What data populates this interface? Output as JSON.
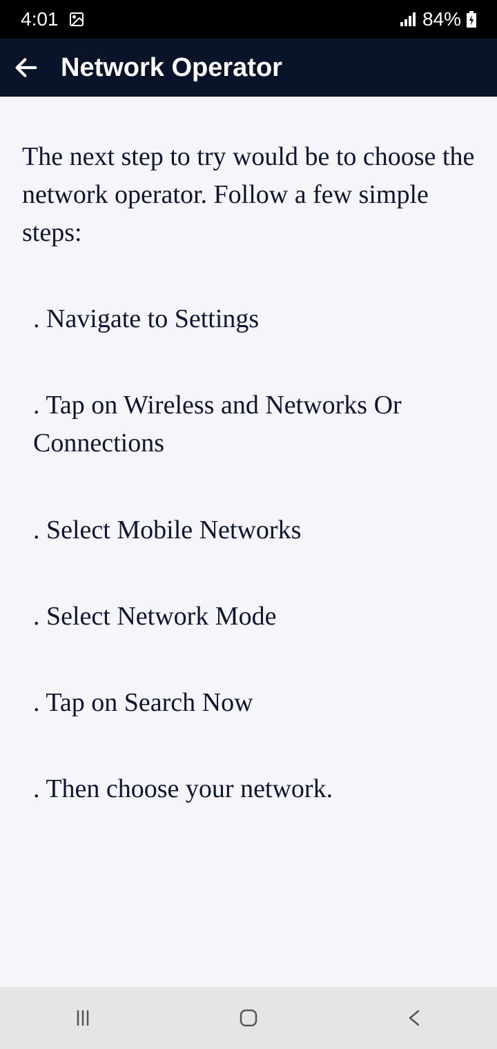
{
  "status": {
    "time": "4:01",
    "battery": "84%"
  },
  "header": {
    "title": "Network Operator"
  },
  "content": {
    "intro": "The next step to try would be to choose the network operator. Follow a few simple steps:",
    "steps": [
      ". Navigate to Settings",
      ". Tap on Wireless and Networks Or Connections",
      ". Select Mobile Networks",
      ". Select Network Mode",
      ". Tap on Search Now",
      ". Then choose your network."
    ]
  }
}
